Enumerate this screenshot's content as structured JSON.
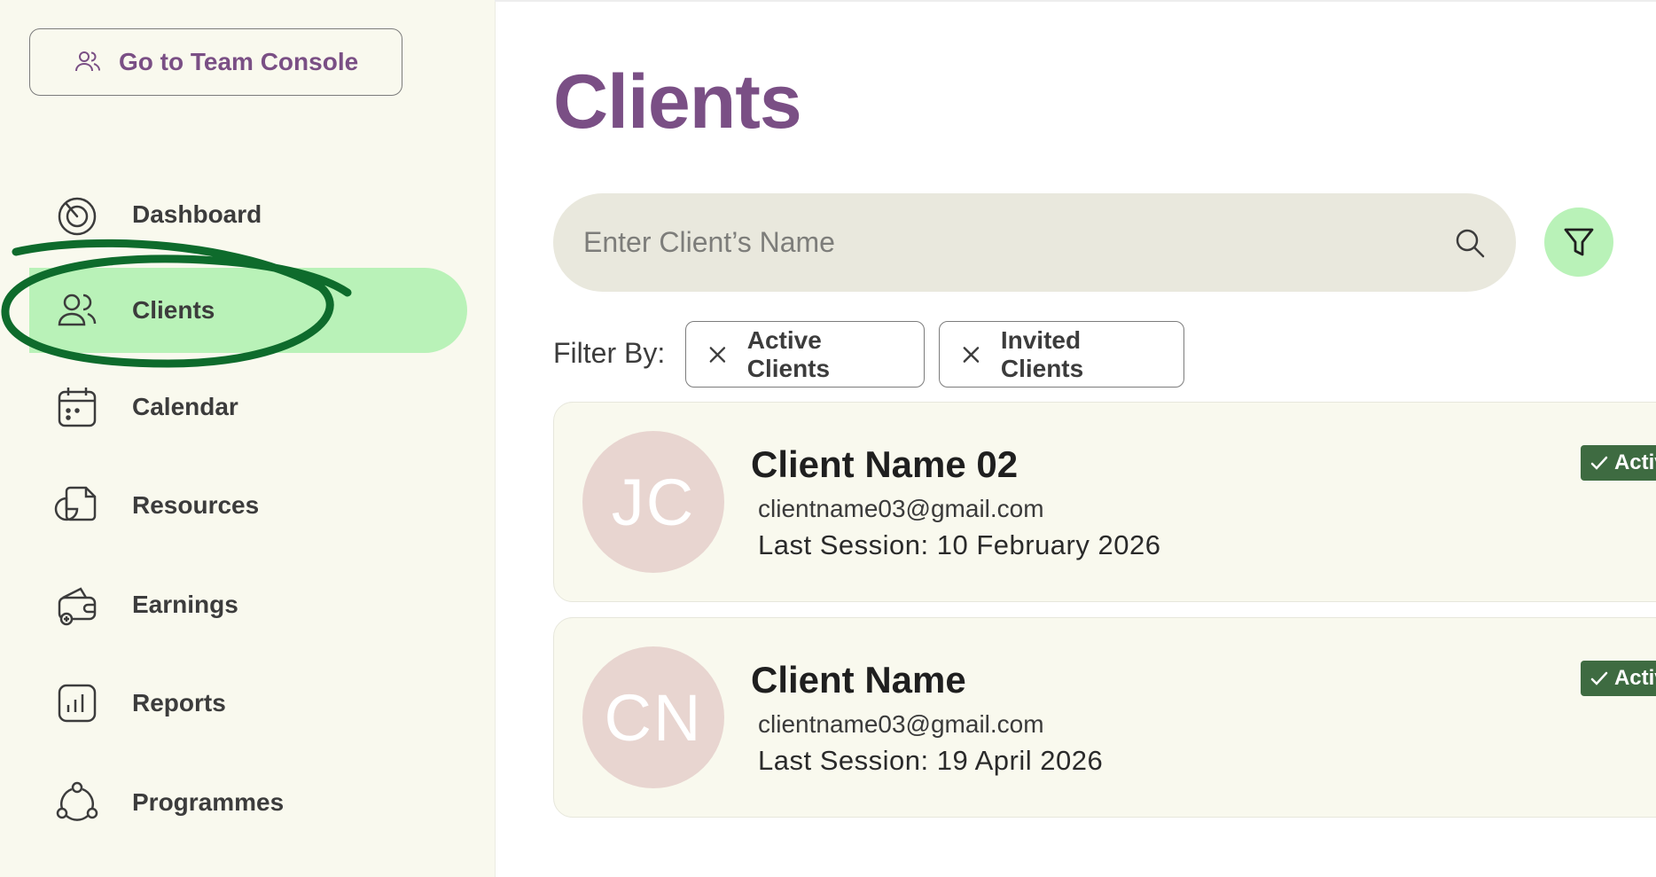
{
  "sidebar": {
    "team_console_label": "Go to Team Console",
    "items": [
      {
        "label": "Dashboard",
        "icon": "dashboard-icon"
      },
      {
        "label": "Clients",
        "icon": "users-icon",
        "active": true
      },
      {
        "label": "Calendar",
        "icon": "calendar-icon"
      },
      {
        "label": "Resources",
        "icon": "resources-icon"
      },
      {
        "label": "Earnings",
        "icon": "wallet-icon"
      },
      {
        "label": "Reports",
        "icon": "reports-icon"
      },
      {
        "label": "Programmes",
        "icon": "programmes-icon"
      }
    ]
  },
  "main": {
    "title": "Clients",
    "search": {
      "placeholder": "Enter Client’s Name",
      "icon": "search-icon"
    },
    "filter_button_icon": "filter-icon",
    "filter_by_label": "Filter By:",
    "chips": [
      {
        "label": "Active Clients",
        "icon": "close-icon"
      },
      {
        "label": "Invited Clients",
        "icon": "close-icon"
      }
    ],
    "clients": [
      {
        "initials": "JC",
        "name": "Client Name 02",
        "email": "clientname03@gmail.com",
        "session_label": "Last Session:",
        "session_date": "10 February 2026",
        "status": "Active"
      },
      {
        "initials": "CN",
        "name": "Client Name",
        "email": "clientname03@gmail.com",
        "session_label": "Last Session:",
        "session_date": "19 April 2026",
        "status": "Active"
      }
    ]
  },
  "colors": {
    "brand_purple": "#7a4f85",
    "active_green": "#b9f2b8",
    "badge_green": "#3e6b41",
    "sidebar_bg": "#f9f9ee",
    "annotation_green": "#0e6b2c"
  }
}
